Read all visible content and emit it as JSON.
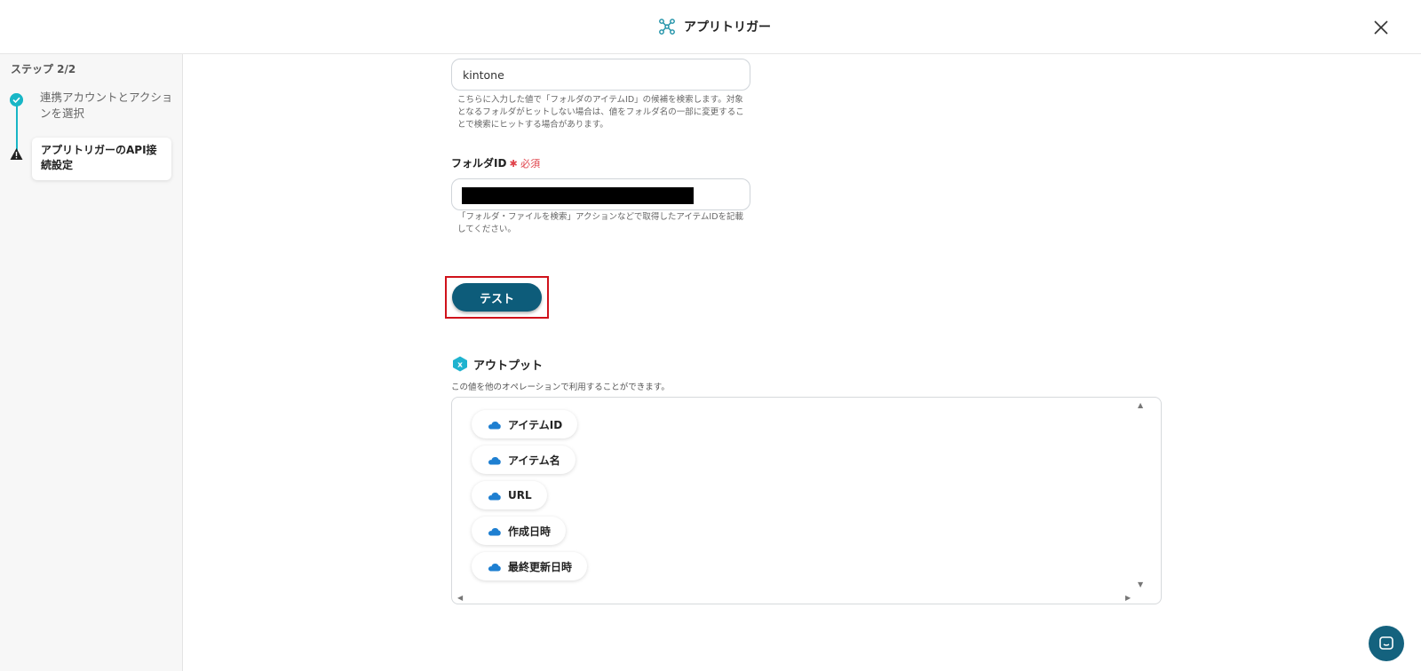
{
  "header": {
    "title": "アプリトリガー",
    "logo_icon": "yoom-logo-icon",
    "close_icon": "close-icon"
  },
  "sidebar": {
    "step_count": "ステップ 2/2",
    "steps": [
      {
        "label": "連携アカウントとアクションを選択",
        "status": "complete"
      },
      {
        "label": "アプリトリガーのAPI接続設定",
        "status": "warning"
      }
    ]
  },
  "form": {
    "search_field": {
      "value": "kintone",
      "help": "こちらに入力した値で「フォルダのアイテムID」の候補を検索します。対象となるフォルダがヒットしない場合は、値をフォルダ名の一部に変更することで検索にヒットする場合があります。"
    },
    "folder_id": {
      "label": "フォルダID",
      "required_label": "必須",
      "help": "「フォルダ・ファイルを検索」アクションなどで取得したアイテムIDを記載してください。"
    },
    "test_button": "テスト"
  },
  "output": {
    "title": "アウトプット",
    "description": "この値を他のオペレーションで利用することができます。",
    "items": [
      "アイテムID",
      "アイテム名",
      "URL",
      "作成日時",
      "最終更新日時"
    ],
    "item_icon": "onedrive-cloud-icon"
  },
  "colors": {
    "accent": "#18b6c6",
    "primary_button": "#0d5c7a",
    "highlight_border": "#d0121b",
    "required": "#e0434b"
  }
}
